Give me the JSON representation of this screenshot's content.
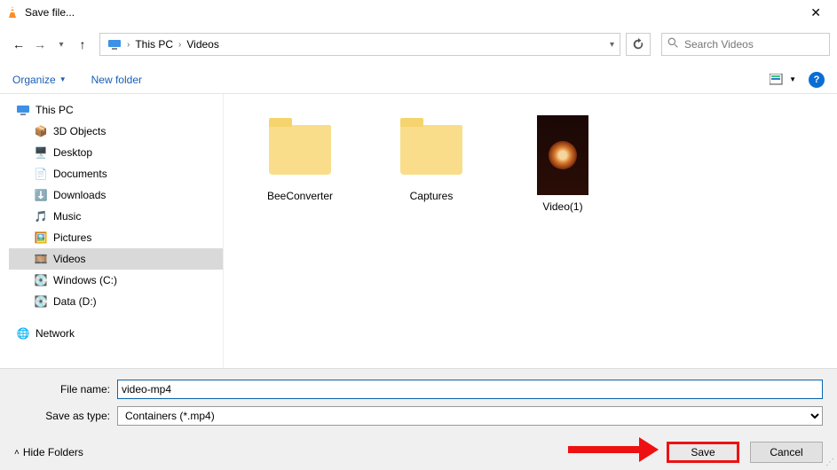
{
  "window": {
    "title": "Save file..."
  },
  "nav": {
    "breadcrumbs": [
      "This PC",
      "Videos"
    ],
    "search_placeholder": "Search Videos"
  },
  "toolbar": {
    "organize": "Organize",
    "new_folder": "New folder"
  },
  "tree": {
    "root": "This PC",
    "items": [
      {
        "label": "3D Objects",
        "icon": "📦"
      },
      {
        "label": "Desktop",
        "icon": "🖥️"
      },
      {
        "label": "Documents",
        "icon": "📄"
      },
      {
        "label": "Downloads",
        "icon": "⬇️"
      },
      {
        "label": "Music",
        "icon": "🎵"
      },
      {
        "label": "Pictures",
        "icon": "🖼️"
      },
      {
        "label": "Videos",
        "icon": "🎞️",
        "selected": true
      },
      {
        "label": "Windows (C:)",
        "icon": "💽"
      },
      {
        "label": "Data (D:)",
        "icon": "💽"
      }
    ],
    "network": "Network"
  },
  "files": [
    {
      "name": "BeeConverter",
      "type": "folder"
    },
    {
      "name": "Captures",
      "type": "folder"
    },
    {
      "name": "Video(1)",
      "type": "video"
    }
  ],
  "footer": {
    "file_name_label": "File name:",
    "file_name_value": "video-mp4",
    "save_type_label": "Save as type:",
    "save_type_value": "Containers (*.mp4)",
    "hide_folders": "Hide Folders",
    "save": "Save",
    "cancel": "Cancel"
  }
}
